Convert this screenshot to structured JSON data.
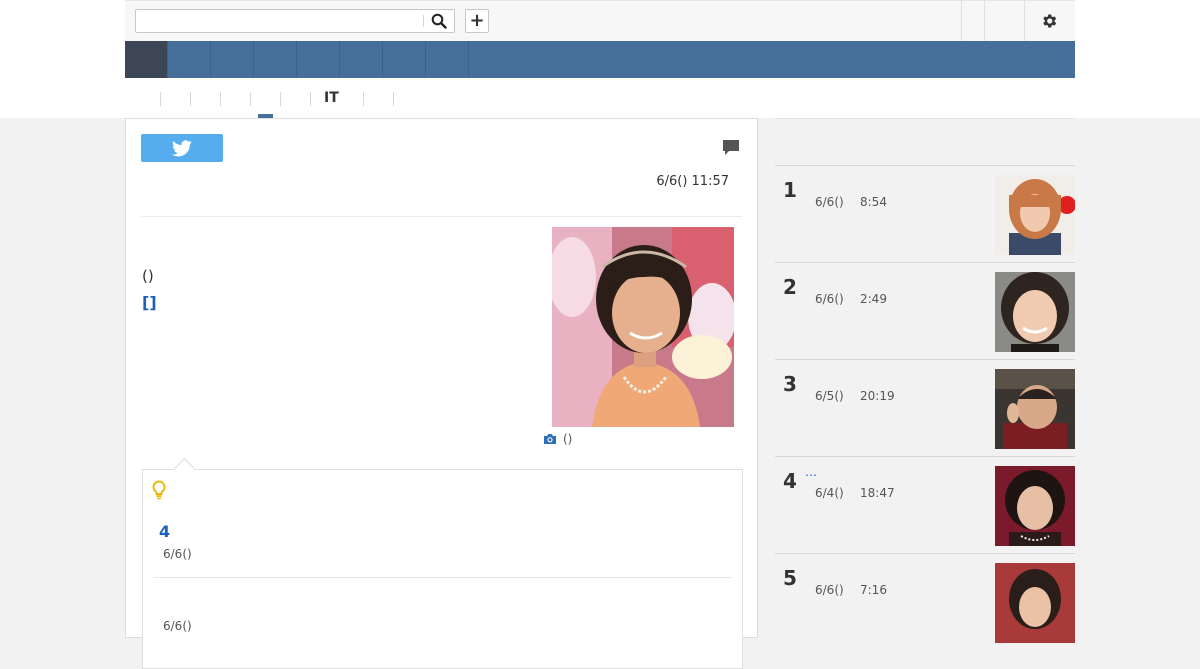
{
  "header": {
    "search_placeholder": "",
    "add_label": "+"
  },
  "subnav": {
    "label": "IT"
  },
  "article": {
    "timestamp": "6/6() 11:57",
    "paren_text": "()",
    "link_text": "[]",
    "photo_caption": "()"
  },
  "related": {
    "number": "4",
    "date1": "6/6()",
    "date2": "6/6()"
  },
  "ranking": [
    {
      "rank": "1",
      "date": "6/6()",
      "time": "8:54",
      "extra": ""
    },
    {
      "rank": "2",
      "date": "6/6()",
      "time": "2:49",
      "extra": ""
    },
    {
      "rank": "3",
      "date": "6/5()",
      "time": "20:19",
      "extra": ""
    },
    {
      "rank": "4",
      "date": "6/4()",
      "time": "18:47",
      "extra": "…"
    },
    {
      "rank": "5",
      "date": "6/6()",
      "time": "7:16",
      "extra": ""
    }
  ],
  "colors": {
    "nav_blue": "#46709a",
    "nav_active": "#3c4654",
    "link_blue": "#1a5fbd",
    "twitter_blue": "#55acee",
    "bulb_yellow": "#f5c518"
  },
  "icons": {
    "search": "search-icon",
    "gear": "gear-icon",
    "twitter": "twitter-bird-icon",
    "comment": "comment-icon",
    "camera": "camera-icon",
    "bulb": "lightbulb-icon"
  }
}
